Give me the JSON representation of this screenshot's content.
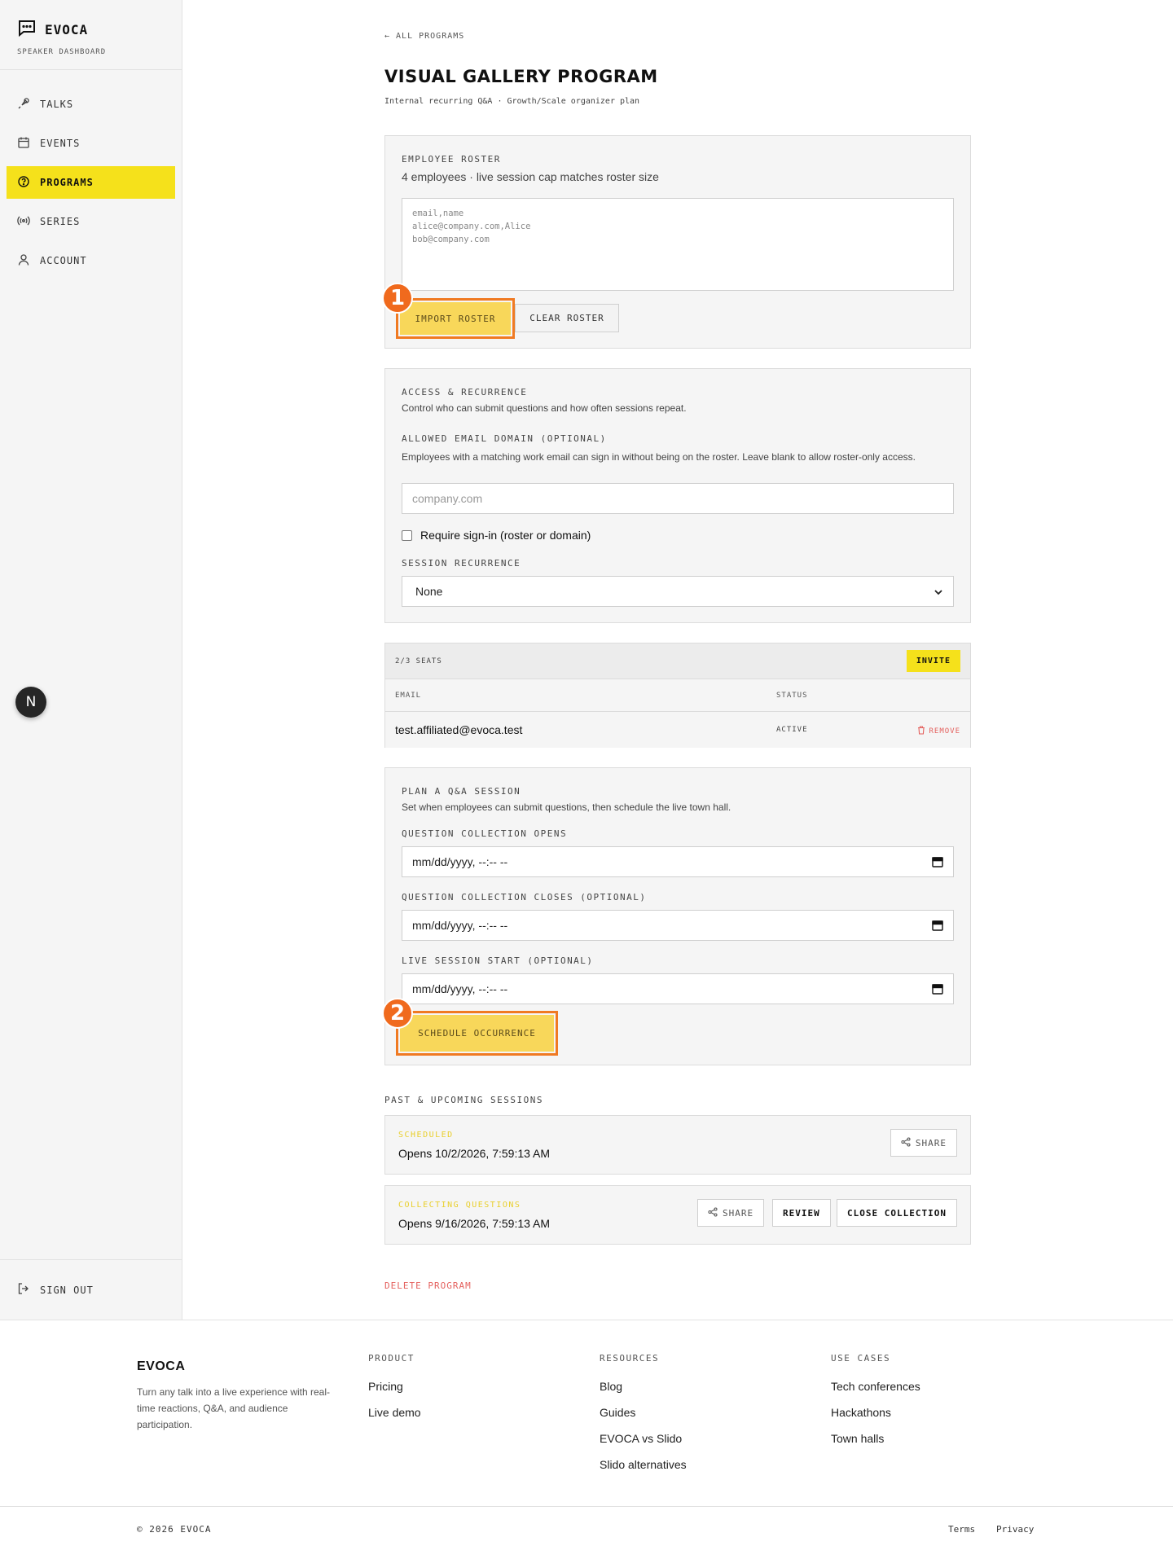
{
  "brand": {
    "name": "EVOCA",
    "subtitle": "SPEAKER DASHBOARD"
  },
  "sidebar": {
    "items": [
      {
        "label": "TALKS",
        "icon": "microphone-icon"
      },
      {
        "label": "EVENTS",
        "icon": "calendar-icon"
      },
      {
        "label": "PROGRAMS",
        "icon": "question-circle-icon",
        "active": true
      },
      {
        "label": "SERIES",
        "icon": "broadcast-icon"
      },
      {
        "label": "ACCOUNT",
        "icon": "user-icon"
      }
    ],
    "badge": "N",
    "signout": "SIGN OUT"
  },
  "page": {
    "back": "← ALL PROGRAMS",
    "title": "VISUAL GALLERY PROGRAM",
    "subtitle": "Internal recurring Q&A · Growth/Scale organizer plan"
  },
  "roster": {
    "label": "EMPLOYEE ROSTER",
    "desc": "4 employees · live session cap matches roster size",
    "placeholder": "email,name\nalice@company.com,Alice\nbob@company.com",
    "import_label": "IMPORT ROSTER",
    "clear_label": "CLEAR ROSTER",
    "marker": "1"
  },
  "access": {
    "label": "ACCESS & RECURRENCE",
    "desc": "Control who can submit questions and how often sessions repeat.",
    "domain_label": "ALLOWED EMAIL DOMAIN (OPTIONAL)",
    "domain_desc": "Employees with a matching work email can sign in without being on the roster. Leave blank to allow roster-only access.",
    "domain_placeholder": "company.com",
    "require_signin": "Require sign-in (roster or domain)",
    "recurrence_label": "SESSION RECURRENCE",
    "recurrence_value": "None"
  },
  "seats": {
    "count": "2/3 SEATS",
    "invite": "INVITE",
    "col_email": "EMAIL",
    "col_status": "STATUS",
    "rows": [
      {
        "email": "test.affiliated@evoca.test",
        "status": "ACTIVE",
        "action": "REMOVE"
      }
    ]
  },
  "plan": {
    "label": "PLAN A Q&A SESSION",
    "desc": "Set when employees can submit questions, then schedule the live town hall.",
    "opens_label": "QUESTION COLLECTION OPENS",
    "closes_label": "QUESTION COLLECTION CLOSES (OPTIONAL)",
    "live_label": "LIVE SESSION START (OPTIONAL)",
    "date_placeholder": "mm/dd/yyyy, --:-- --",
    "schedule_label": "SCHEDULE OCCURRENCE",
    "marker": "2"
  },
  "sessions": {
    "label": "PAST & UPCOMING SESSIONS",
    "items": [
      {
        "status": "SCHEDULED",
        "opens": "Opens 10/2/2026, 7:59:13 AM",
        "share": "SHARE"
      },
      {
        "status": "COLLECTING QUESTIONS",
        "opens": "Opens 9/16/2026, 7:59:13 AM",
        "share": "SHARE",
        "review": "REVIEW",
        "close": "CLOSE COLLECTION"
      }
    ]
  },
  "delete_label": "DELETE PROGRAM",
  "footer": {
    "brand": "EVOCA",
    "tagline": "Turn any talk into a live experience with real-time reactions, Q&A, and audience participation.",
    "columns": [
      {
        "title": "PRODUCT",
        "links": [
          "Pricing",
          "Live demo"
        ]
      },
      {
        "title": "RESOURCES",
        "links": [
          "Blog",
          "Guides",
          "EVOCA vs Slido",
          "Slido alternatives"
        ]
      },
      {
        "title": "USE CASES",
        "links": [
          "Tech conferences",
          "Hackathons",
          "Town halls"
        ]
      }
    ],
    "copyright": "© 2026 EVOCA",
    "terms": "Terms",
    "privacy": "Privacy"
  },
  "colors": {
    "accent": "#f5e11b",
    "highlight": "#f07a22",
    "danger": "#e4605d",
    "status_yellow": "#e9cf2c"
  }
}
